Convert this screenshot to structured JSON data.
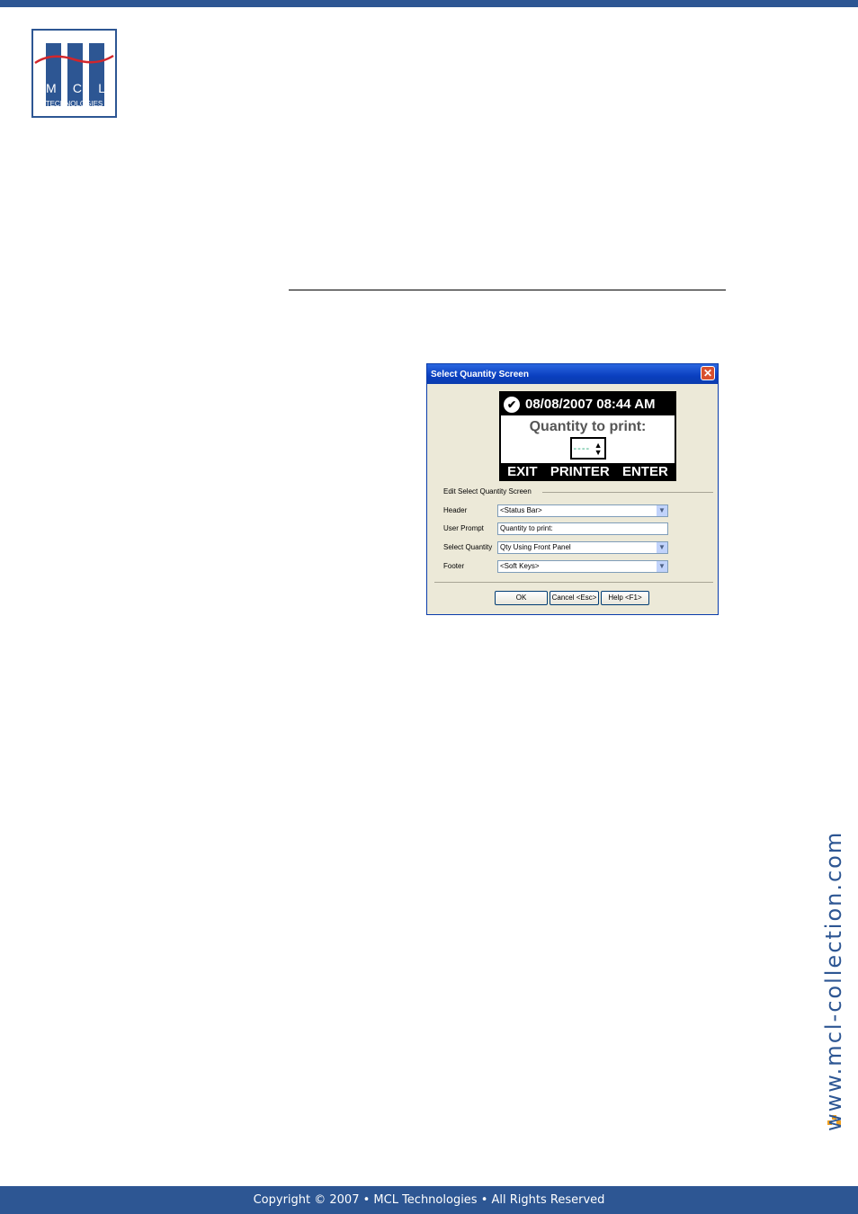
{
  "logo": {
    "letters": [
      "M",
      "C",
      "L"
    ],
    "subtitle": "TECHNOLOGIES"
  },
  "dialog": {
    "title": "Select Quantity Screen",
    "close_icon": "close-icon",
    "preview": {
      "datetime": "08/08/2007 08:44 AM",
      "prompt": "Quantity to print:",
      "spin_value": "----",
      "softkeys": [
        "EXIT",
        "PRINTER",
        "ENTER"
      ]
    },
    "group_label": "Edit Select Quantity Screen",
    "fields": [
      {
        "label": "Header",
        "value": "<Status Bar>",
        "type": "select"
      },
      {
        "label": "User Prompt",
        "value": "Quantity to print:",
        "type": "text"
      },
      {
        "label": "Select Quantity",
        "value": "Qty Using Front Panel",
        "type": "select"
      },
      {
        "label": "Footer",
        "value": "<Soft Keys>",
        "type": "select"
      }
    ],
    "buttons": {
      "ok": "OK",
      "cancel": "Cancel <Esc>",
      "help": "Help <F1>"
    }
  },
  "side_url": "www.mcl-collection.com",
  "footer": "Copyright © 2007 • MCL Technologies • All Rights Reserved",
  "colors": {
    "brand": "#2d5693",
    "accent": "#f0a020"
  }
}
